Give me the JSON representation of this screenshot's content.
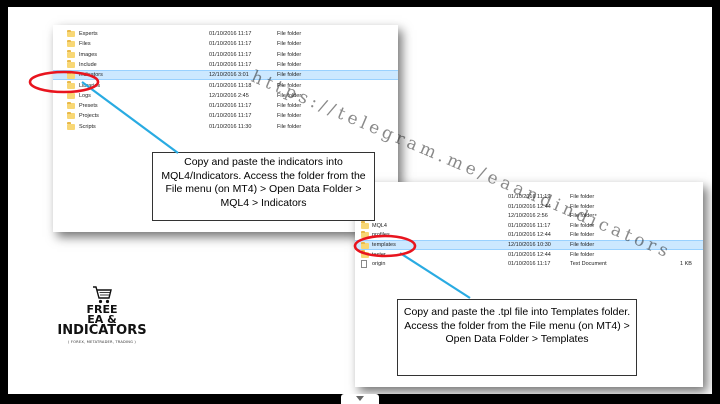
{
  "explorer_top": {
    "rows": [
      {
        "name": "Experts",
        "date": "01/10/2016 11:17",
        "type": "File folder",
        "selected": false
      },
      {
        "name": "Files",
        "date": "01/10/2016 11:17",
        "type": "File folder",
        "selected": false
      },
      {
        "name": "Images",
        "date": "01/10/2016 11:17",
        "type": "File folder",
        "selected": false
      },
      {
        "name": "Include",
        "date": "01/10/2016 11:17",
        "type": "File folder",
        "selected": false
      },
      {
        "name": "Indicators",
        "date": "12/10/2016 3:01",
        "type": "File folder",
        "selected": true
      },
      {
        "name": "Libraries",
        "date": "01/10/2016 11:18",
        "type": "File folder",
        "selected": false
      },
      {
        "name": "Logs",
        "date": "12/10/2016 2:45",
        "type": "File folder",
        "selected": false
      },
      {
        "name": "Presets",
        "date": "01/10/2016 11:17",
        "type": "File folder",
        "selected": false
      },
      {
        "name": "Projects",
        "date": "01/10/2016 11:17",
        "type": "File folder",
        "selected": false
      },
      {
        "name": "Scripts",
        "date": "01/10/2016 11:30",
        "type": "File folder",
        "selected": false
      }
    ]
  },
  "explorer_bottom": {
    "rows": [
      {
        "name": "",
        "date": "01/10/2016 11:19",
        "type": "File folder",
        "size": "",
        "icon": "folder",
        "selected": false
      },
      {
        "name": "",
        "date": "01/10/2016 12:44",
        "type": "File folder",
        "size": "",
        "icon": "folder",
        "selected": false
      },
      {
        "name": "",
        "date": "12/10/2016 2:56",
        "type": "File folder",
        "size": "",
        "icon": "folder",
        "selected": false
      },
      {
        "name": "MQL4",
        "date": "01/10/2016 11:17",
        "type": "File folder",
        "size": "",
        "icon": "folder",
        "selected": false
      },
      {
        "name": "profiles",
        "date": "01/10/2016 12:44",
        "type": "File folder",
        "size": "",
        "icon": "folder",
        "selected": false
      },
      {
        "name": "templates",
        "date": "12/10/2016 10:30",
        "type": "File folder",
        "size": "",
        "icon": "folder",
        "selected": true
      },
      {
        "name": "tester",
        "date": "01/10/2016 12:44",
        "type": "File folder",
        "size": "",
        "icon": "folder",
        "selected": false
      },
      {
        "name": "origin",
        "date": "01/10/2016 11:17",
        "type": "Text Document",
        "size": "1 KB",
        "icon": "text",
        "selected": false
      }
    ]
  },
  "callout_top": {
    "text": "Copy and paste the indicators into MQL4/Indicators. Access the folder from the File menu (on MT4) > Open Data Folder > MQL4 > Indicators"
  },
  "callout_bottom": {
    "text": "Copy and paste the .tpl file into Templates folder. Access the folder from the File menu (on MT4) > Open Data Folder > Templates"
  },
  "watermark": "https://telegram.me/eaandindicators",
  "logo": {
    "line1": "FREE",
    "line2": "EA &",
    "line3": "INDICATORS",
    "tagline": "( FOREX, METATRADER, TRADING )"
  },
  "colors": {
    "annotation_circle": "#e8141e",
    "arrow_line": "#29abe2",
    "selection_bg": "#cce8ff",
    "folder_yellow": "#f8d775",
    "frame_bg": "#000000"
  }
}
